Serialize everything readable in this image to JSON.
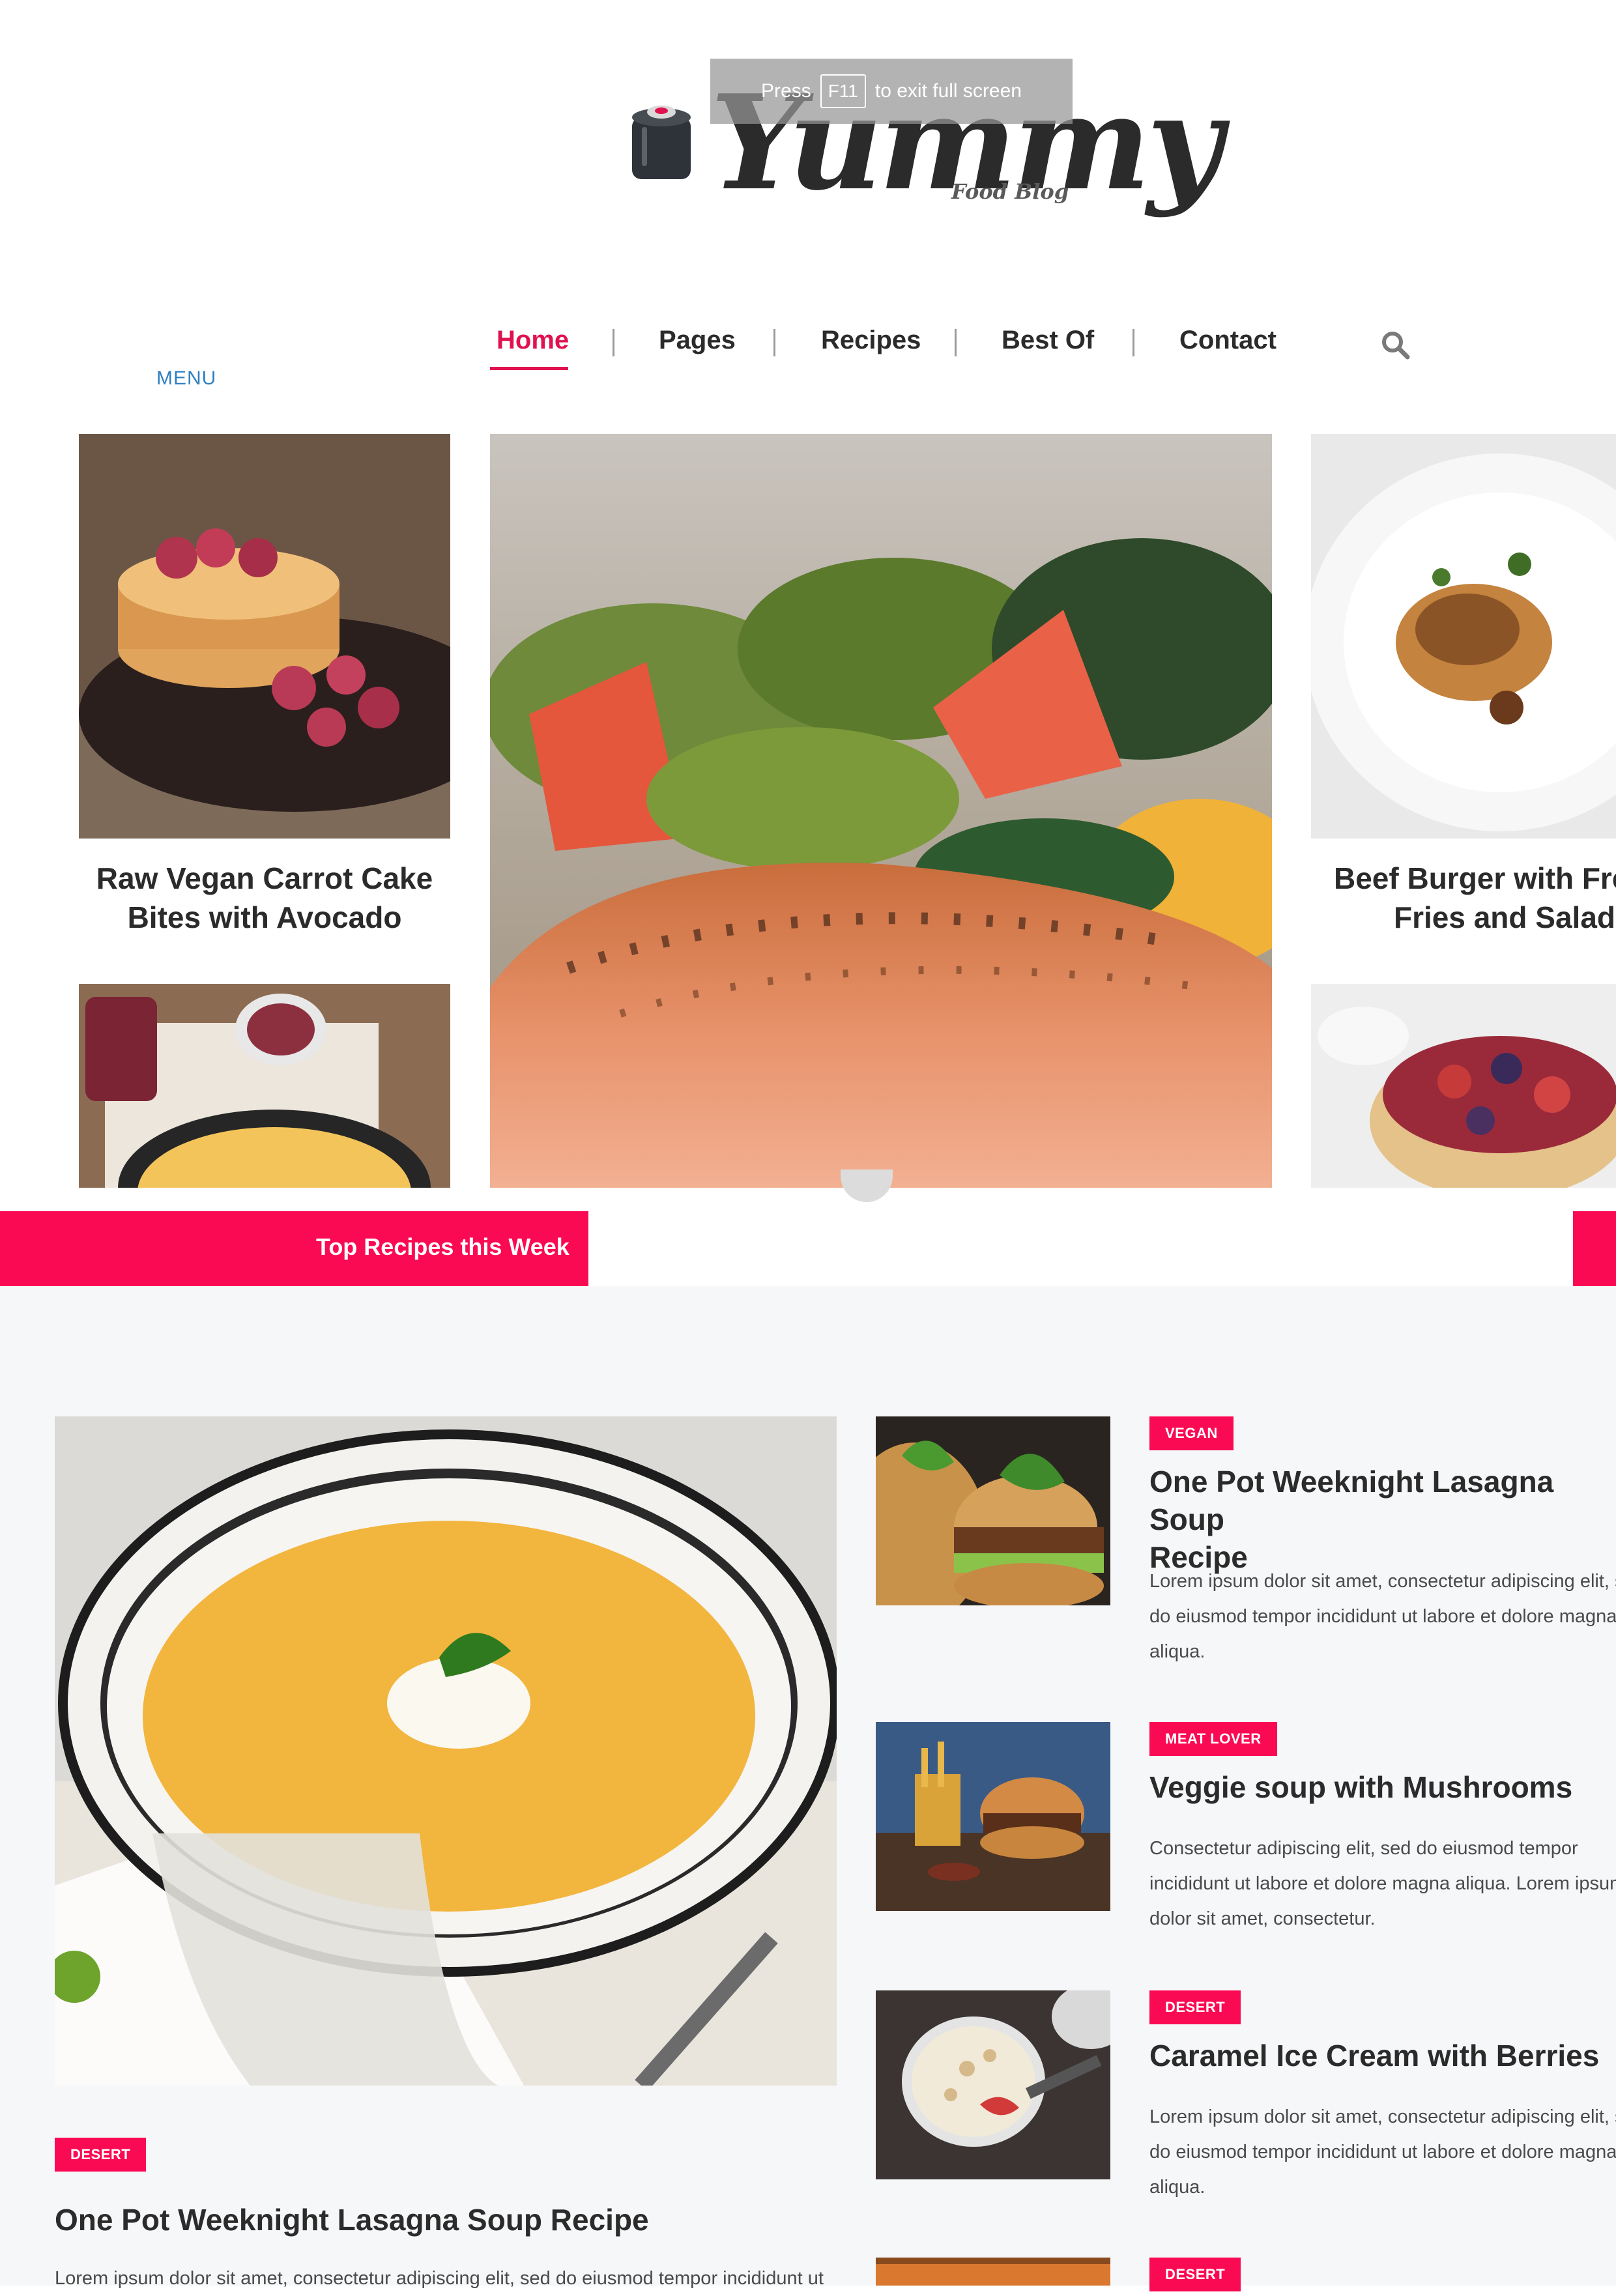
{
  "browser": {
    "fullscreen_hint_before": "Press",
    "fullscreen_hint_key": "F11",
    "fullscreen_hint_after": "to exit full screen"
  },
  "header": {
    "logo_text": "Yummy",
    "logo_subtitle": "Food Blog",
    "logo_icon": "cooking-pot-icon"
  },
  "nav": {
    "items": [
      {
        "label": "Home",
        "active": true
      },
      {
        "label": "Pages"
      },
      {
        "label": "Recipes"
      },
      {
        "label": "Best Of"
      },
      {
        "label": "Contact"
      }
    ],
    "menu_label": "MENU",
    "search_icon": "search-icon"
  },
  "slider": {
    "left_title_line1": "Raw Vegan Carrot Cake",
    "left_title_line2": "Bites with Avocado",
    "right_title_line1": "Beef Burger with French",
    "right_title_line2": "Fries and Salad"
  },
  "top_recipes": {
    "label": "Top Recipes this Week"
  },
  "featured": {
    "badge": "DESERT",
    "title": "One Pot Weeknight Lasagna Soup Recipe",
    "desc": "Lorem ipsum dolor sit amet, consectetur adipiscing elit, sed do eiusmod tempor incididunt ut"
  },
  "side_recipes": [
    {
      "badge": "VEGAN",
      "title_line1": "One Pot Weeknight Lasagna Soup",
      "title_line2": "Recipe",
      "desc_line1": "Lorem ipsum dolor sit amet, consectetur adipiscing elit, sed",
      "desc_line2": "do eiusmod tempor incididunt ut labore et dolore magna",
      "desc_line3": "aliqua."
    },
    {
      "badge": "MEAT LOVER",
      "title_line1": "Veggie soup with Mushrooms",
      "desc_line1": "Consectetur adipiscing elit, sed do eiusmod tempor",
      "desc_line2": "incididunt ut labore et dolore magna aliqua. Lorem ipsum",
      "desc_line3": "dolor sit amet, consectetur."
    },
    {
      "badge": "DESERT",
      "title_line1": "Caramel Ice Cream with Berries",
      "desc_line1": "Lorem ipsum dolor sit amet, consectetur adipiscing elit, sed",
      "desc_line2": "do eiusmod tempor incididunt ut labore et dolore magna",
      "desc_line3": "aliqua."
    },
    {
      "badge": "DESERT"
    }
  ],
  "colors": {
    "accent": "#fb0a54",
    "text": "#2b2b2b",
    "menu_link": "#2f7fc1"
  }
}
